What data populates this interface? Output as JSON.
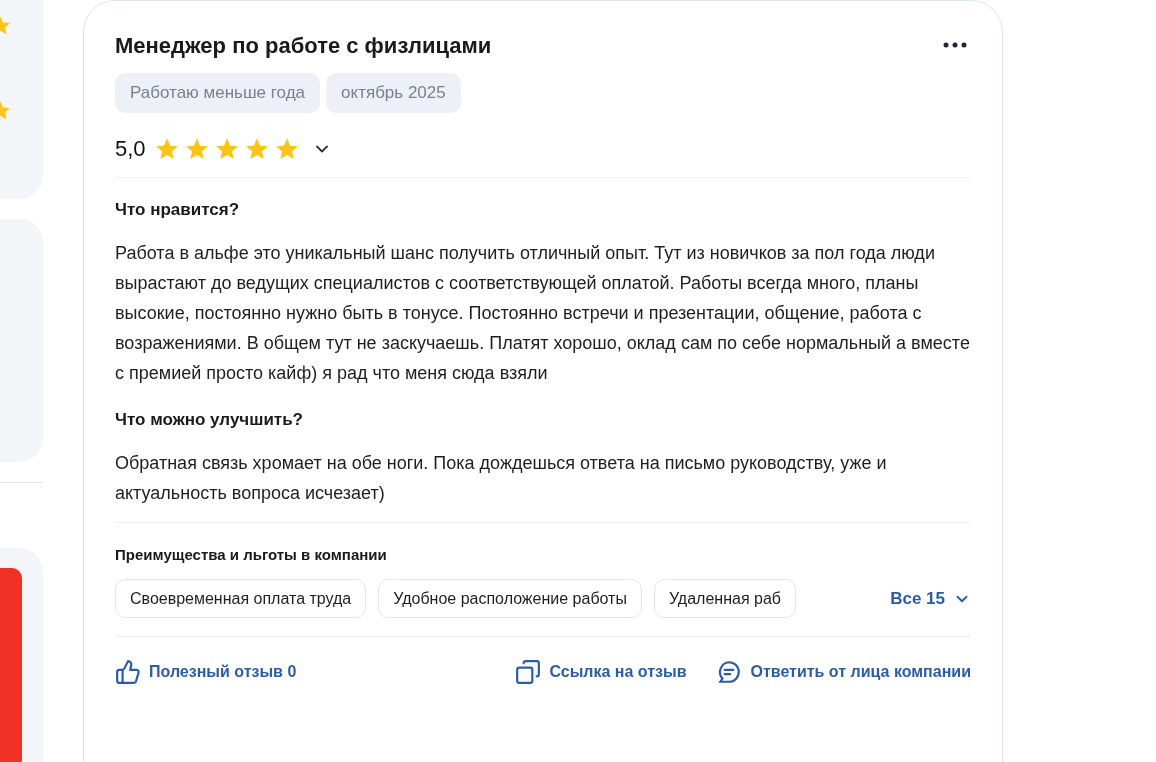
{
  "review": {
    "title": "Менеджер по работе с физлицами",
    "tags": [
      "Работаю меньше года",
      "октябрь 2025"
    ],
    "rating": "5,0",
    "stars": 5,
    "sections": [
      {
        "heading": "Что нравится?",
        "text": "Работа в альфе это уникальный шанс получить отличный опыт. Тут из новичков за пол года люди вырастают до ведущих специалистов с соответствующей оплатой. Работы всегда много, планы высокие, постоянно нужно быть в тонусе. Постоянно встречи и презентации, общение, работа с возражениями. В общем тут не заскучаешь. Платят хорошо, оклад сам по себе нормальный а вместе с премией просто кайф) я рад что меня сюда взяли"
      },
      {
        "heading": "Что можно улучшить?",
        "text": "Обратная связь хромает на обе ноги. Пока дождешься ответа на письмо руководству, уже и актуальность вопроса исчезает)"
      }
    ],
    "benefits": {
      "heading": "Преимущества и льготы в компании",
      "items": [
        "Своевременная оплата труда",
        "Удобное расположение работы",
        "Удаленная раб"
      ],
      "more": "Все 15"
    },
    "actions": [
      {
        "kind": "like",
        "label": "Полезный отзыв 0"
      },
      {
        "kind": "link",
        "label": "Ссылка на отзыв"
      },
      {
        "kind": "reply",
        "label": "Ответить от лица компании"
      }
    ]
  }
}
